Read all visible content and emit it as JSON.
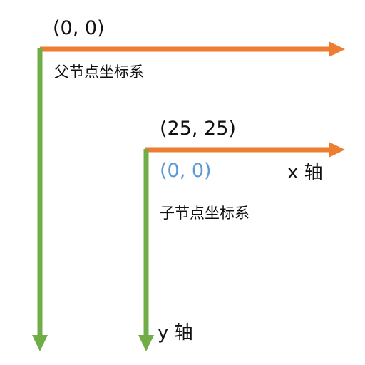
{
  "colors": {
    "x_axis": "#ED7D31",
    "y_axis": "#70AD47",
    "child_origin_label": "#5B9BD5",
    "text": "#111111"
  },
  "parent": {
    "origin_label": "(0, 0)",
    "system_label": "父节点坐标系"
  },
  "child": {
    "position_label": "(25, 25)",
    "origin_label": "(0, 0)",
    "system_label": "子节点坐标系"
  },
  "axes": {
    "x_label": "x 轴",
    "y_label": "y 轴"
  }
}
